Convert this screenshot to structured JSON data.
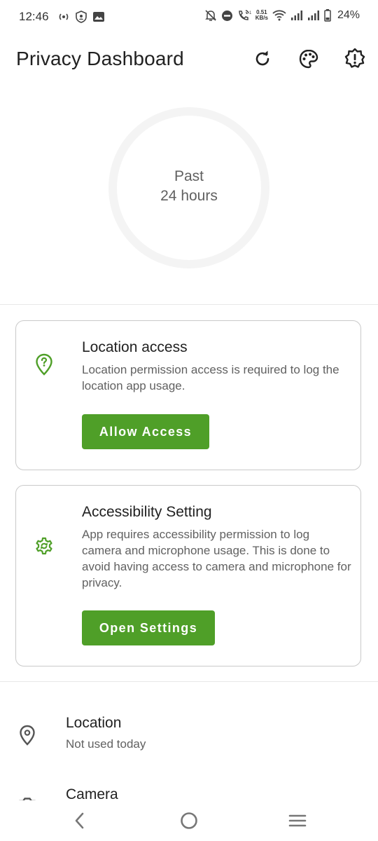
{
  "status_bar": {
    "time": "12:46",
    "net_speed_value": "0.51",
    "net_speed_unit": "KB/s",
    "battery_percent": "24%"
  },
  "app_bar": {
    "title": "Privacy Dashboard",
    "actions": [
      "refresh-icon",
      "palette-icon",
      "alert-badge-icon"
    ]
  },
  "summary": {
    "line1": "Past",
    "line2": "24 hours"
  },
  "cards": {
    "location": {
      "icon": "location-question-icon",
      "title": "Location access",
      "body": "Location permission access is required to log the location app usage.",
      "button_label": "Allow Access"
    },
    "accessibility": {
      "icon": "accessibility-settings-icon",
      "title": "Accessibility Setting",
      "body": "App requires accessibility permission to log camera and microphone usage. This is done to avoid having access to camera and microphone for privacy.",
      "button_label": "Open Settings"
    }
  },
  "usage_list": {
    "location": {
      "icon": "location-pin-icon",
      "title": "Location",
      "subtitle": "Not used today"
    },
    "camera": {
      "icon": "camera-icon",
      "title": "Camera"
    }
  },
  "colors": {
    "accent": "#4f9f28",
    "icon_green": "#4f9f28",
    "ring": "#f4f4f4"
  }
}
